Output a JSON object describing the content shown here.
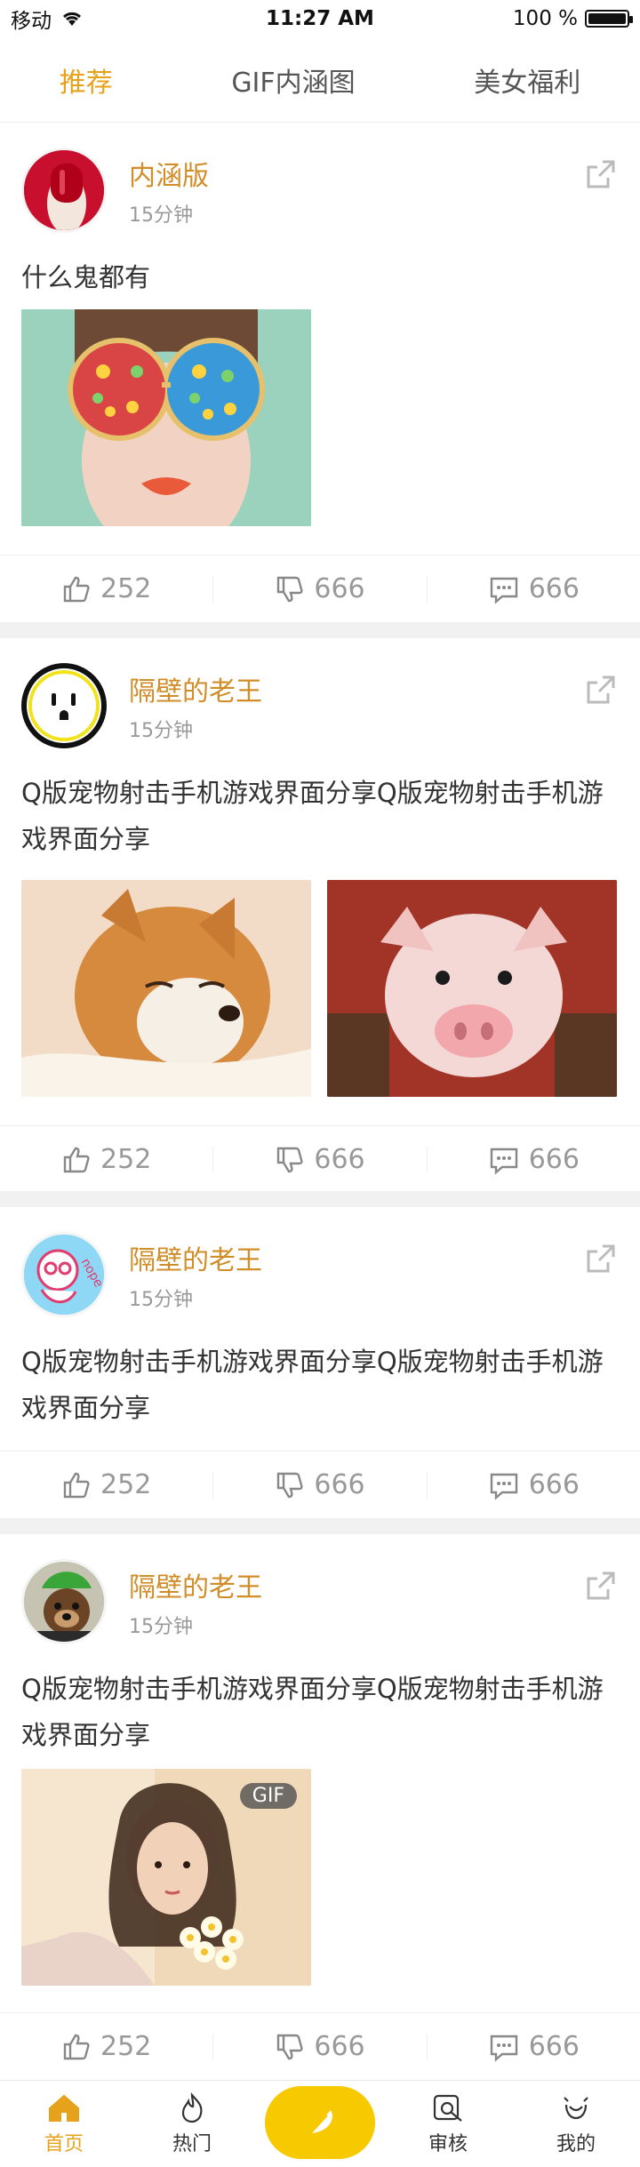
{
  "status_bar": {
    "carrier": "移动",
    "time": "11:27 AM",
    "battery": "100 %"
  },
  "tabs": [
    {
      "label": "推荐"
    },
    {
      "label": "GIF内涵图"
    },
    {
      "label": "美女福利"
    }
  ],
  "posts": [
    {
      "username": "内涵版",
      "time": "15分钟",
      "text": "什么鬼都有",
      "likes": "252",
      "dislikes": "666",
      "comments": "666"
    },
    {
      "username": "隔壁的老王",
      "time": "15分钟",
      "text": "Q版宠物射击手机游戏界面分享Q版宠物射击手机游戏界面分享",
      "likes": "252",
      "dislikes": "666",
      "comments": "666"
    },
    {
      "username": "隔壁的老王",
      "time": "15分钟",
      "text": "Q版宠物射击手机游戏界面分享Q版宠物射击手机游戏界面分享",
      "likes": "252",
      "dislikes": "666",
      "comments": "666"
    },
    {
      "username": "隔壁的老王",
      "time": "15分钟",
      "text": "Q版宠物射击手机游戏界面分享Q版宠物射击手机游戏界面分享",
      "badge": "GIF",
      "likes": "252",
      "dislikes": "666",
      "comments": "666"
    }
  ],
  "bottom_nav": [
    {
      "label": "首页"
    },
    {
      "label": "热门"
    },
    {
      "label": "审核"
    },
    {
      "label": "我的"
    }
  ],
  "colors": {
    "accent": "#e6a21a",
    "username": "#d18d28",
    "fab": "#f7c900"
  }
}
